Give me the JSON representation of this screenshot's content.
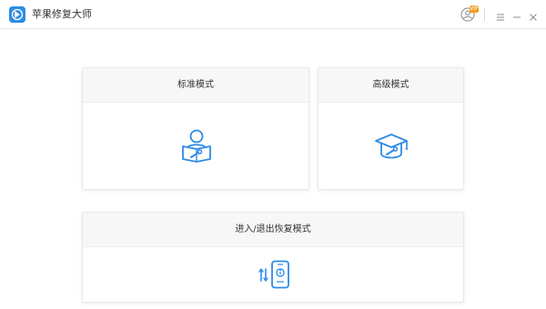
{
  "app": {
    "title": "苹果修复大师",
    "icon": "apple-repair-logo-icon",
    "accent_color": "#2e8be6"
  },
  "titlebar": {
    "user_icon": "user-account-icon",
    "vip_badge": "VIP",
    "menu_icon": "menu-icon",
    "minimize_icon": "minimize-icon",
    "close_icon": "close-icon"
  },
  "modes": {
    "standard": {
      "label": "标准模式",
      "icon": "reader-wrench-icon"
    },
    "advanced": {
      "label": "高级模式",
      "icon": "graduation-cap-wrench-icon"
    },
    "recovery": {
      "label": "进入/退出恢复模式",
      "icon": "phone-switch-icon"
    }
  }
}
